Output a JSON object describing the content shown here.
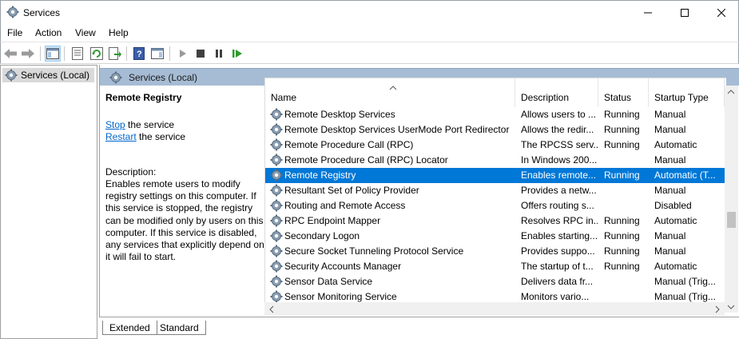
{
  "window": {
    "title": "Services",
    "controls": [
      "minimize",
      "maximize",
      "close"
    ]
  },
  "menu": [
    "File",
    "Action",
    "View",
    "Help"
  ],
  "toolbar": {
    "icons": [
      "back-icon",
      "forward-icon",
      "show-hide-console-tree-icon",
      "properties-icon",
      "refresh-icon",
      "export-list-icon",
      "help-icon",
      "show-hide-action-pane-icon",
      "start-service-icon",
      "stop-service-icon",
      "pause-service-icon",
      "restart-service-icon"
    ]
  },
  "tree": {
    "item": "Services (Local)"
  },
  "pane": {
    "header": "Services (Local)"
  },
  "details": {
    "service_name": "Remote Registry",
    "stop_link": "Stop",
    "stop_suffix": " the service",
    "restart_link": "Restart",
    "restart_suffix": " the service",
    "description_label": "Description:",
    "description": "Enables remote users to modify registry settings on this computer. If this service is stopped, the registry can be modified only by users on this computer. If this service is disabled, any services that explicitly depend on it will fail to start."
  },
  "columns": [
    "Name",
    "Description",
    "Status",
    "Startup Type"
  ],
  "rows": [
    {
      "name": "Remote Desktop Services",
      "description": "Allows users to ...",
      "status": "Running",
      "startup": "Manual"
    },
    {
      "name": "Remote Desktop Services UserMode Port Redirector",
      "description": "Allows the redir...",
      "status": "Running",
      "startup": "Manual"
    },
    {
      "name": "Remote Procedure Call (RPC)",
      "description": "The RPCSS serv...",
      "status": "Running",
      "startup": "Automatic"
    },
    {
      "name": "Remote Procedure Call (RPC) Locator",
      "description": "In Windows 200...",
      "status": "",
      "startup": "Manual"
    },
    {
      "name": "Remote Registry",
      "description": "Enables remote...",
      "status": "Running",
      "startup": "Automatic (T...",
      "selected": true
    },
    {
      "name": "Resultant Set of Policy Provider",
      "description": "Provides a netw...",
      "status": "",
      "startup": "Manual"
    },
    {
      "name": "Routing and Remote Access",
      "description": "Offers routing s...",
      "status": "",
      "startup": "Disabled"
    },
    {
      "name": "RPC Endpoint Mapper",
      "description": "Resolves RPC in...",
      "status": "Running",
      "startup": "Automatic"
    },
    {
      "name": "Secondary Logon",
      "description": "Enables starting...",
      "status": "Running",
      "startup": "Manual"
    },
    {
      "name": "Secure Socket Tunneling Protocol Service",
      "description": "Provides suppo...",
      "status": "Running",
      "startup": "Manual"
    },
    {
      "name": "Security Accounts Manager",
      "description": "The startup of t...",
      "status": "Running",
      "startup": "Automatic"
    },
    {
      "name": "Sensor Data Service",
      "description": "Delivers data fr...",
      "status": "",
      "startup": "Manual (Trig..."
    },
    {
      "name": "Sensor Monitoring Service",
      "description": "Monitors vario...",
      "status": "",
      "startup": "Manual (Trig..."
    }
  ],
  "tabs": [
    "Extended",
    "Standard"
  ],
  "colors": {
    "selection": "#0078d7",
    "pane_header": "#a6bcd4",
    "link": "#0066cc"
  }
}
